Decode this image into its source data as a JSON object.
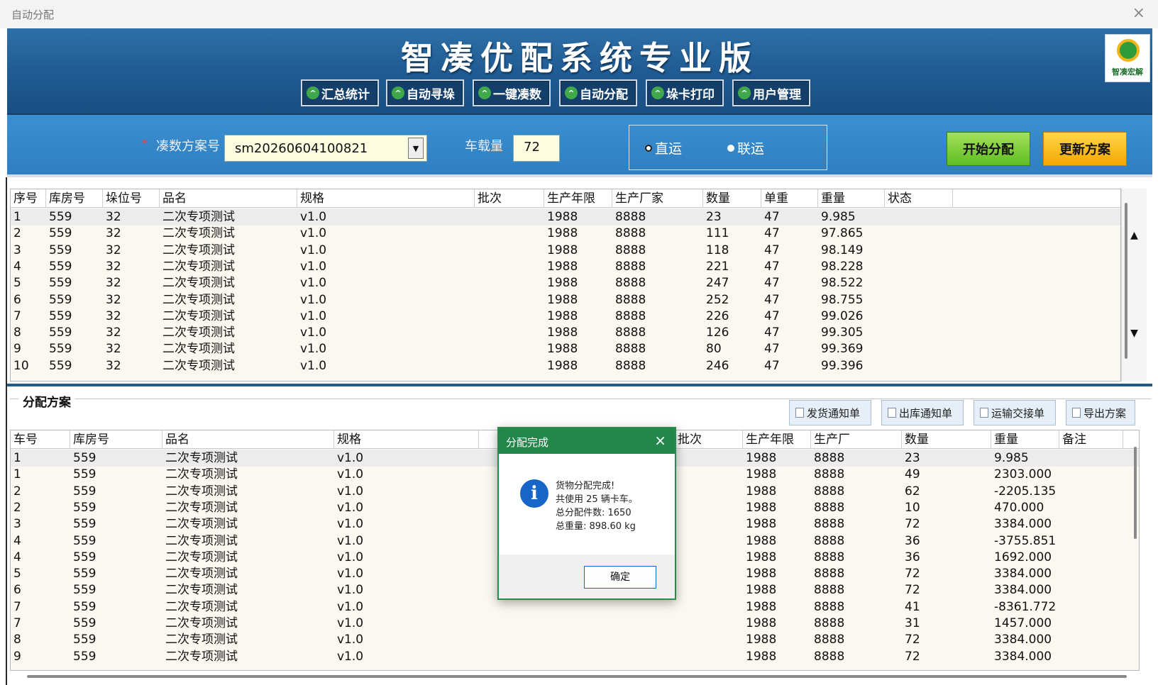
{
  "window": {
    "title": "自动分配"
  },
  "header": {
    "title": "智凑优配系统专业版",
    "nav": [
      "汇总统计",
      "自动寻垛",
      "一键凑数",
      "自动分配",
      "垛卡打印",
      "用户管理"
    ],
    "logo_text": "智凑宏解"
  },
  "controls": {
    "scheme_label": "凑数方案号",
    "scheme_value": "sm20260604100821",
    "load_label": "车载量",
    "load_value": "72",
    "radio_direct": "直运",
    "radio_combined": "联运",
    "start_button": "开始分配",
    "update_button": "更新方案"
  },
  "top_table": {
    "columns": [
      "序号",
      "库房号",
      "垛位号",
      "品名",
      "规格",
      "批次",
      "生产年限",
      "生产厂家",
      "数量",
      "单重",
      "重量",
      "状态"
    ],
    "rows": [
      [
        "1",
        "559",
        "32",
        "二次专项测试",
        "v1.0",
        "",
        "1988",
        "8888",
        "23",
        "47",
        "9.985",
        ""
      ],
      [
        "2",
        "559",
        "32",
        "二次专项测试",
        "v1.0",
        "",
        "1988",
        "8888",
        "111",
        "47",
        "97.865",
        ""
      ],
      [
        "3",
        "559",
        "32",
        "二次专项测试",
        "v1.0",
        "",
        "1988",
        "8888",
        "118",
        "47",
        "98.149",
        ""
      ],
      [
        "4",
        "559",
        "32",
        "二次专项测试",
        "v1.0",
        "",
        "1988",
        "8888",
        "221",
        "47",
        "98.228",
        ""
      ],
      [
        "5",
        "559",
        "32",
        "二次专项测试",
        "v1.0",
        "",
        "1988",
        "8888",
        "247",
        "47",
        "98.522",
        ""
      ],
      [
        "6",
        "559",
        "32",
        "二次专项测试",
        "v1.0",
        "",
        "1988",
        "8888",
        "252",
        "47",
        "98.755",
        ""
      ],
      [
        "7",
        "559",
        "32",
        "二次专项测试",
        "v1.0",
        "",
        "1988",
        "8888",
        "226",
        "47",
        "99.026",
        ""
      ],
      [
        "8",
        "559",
        "32",
        "二次专项测试",
        "v1.0",
        "",
        "1988",
        "8888",
        "126",
        "47",
        "99.305",
        ""
      ],
      [
        "9",
        "559",
        "32",
        "二次专项测试",
        "v1.0",
        "",
        "1988",
        "8888",
        "80",
        "47",
        "99.369",
        ""
      ],
      [
        "10",
        "559",
        "32",
        "二次专项测试",
        "v1.0",
        "",
        "1988",
        "8888",
        "246",
        "47",
        "99.396",
        ""
      ]
    ]
  },
  "section": {
    "title": "分配方案",
    "buttons": [
      "发货通知单",
      "出库通知单",
      "运输交接单",
      "导出方案"
    ]
  },
  "bottom_table": {
    "columns": [
      "车号",
      "库房号",
      "品名",
      "规格",
      "",
      "批次",
      "生产年限",
      "生产厂",
      "数量",
      "重量",
      "备注"
    ],
    "rows": [
      [
        "1",
        "559",
        "二次专项测试",
        "v1.0",
        "",
        "",
        "1988",
        "8888",
        "23",
        "9.985",
        ""
      ],
      [
        "1",
        "559",
        "二次专项测试",
        "v1.0",
        "",
        "",
        "1988",
        "8888",
        "49",
        "2303.000",
        ""
      ],
      [
        "2",
        "559",
        "二次专项测试",
        "v1.0",
        "",
        "",
        "1988",
        "8888",
        "62",
        "-2205.135",
        ""
      ],
      [
        "2",
        "559",
        "二次专项测试",
        "v1.0",
        "",
        "",
        "1988",
        "8888",
        "10",
        "470.000",
        ""
      ],
      [
        "3",
        "559",
        "二次专项测试",
        "v1.0",
        "",
        "",
        "1988",
        "8888",
        "72",
        "3384.000",
        ""
      ],
      [
        "4",
        "559",
        "二次专项测试",
        "v1.0",
        "",
        "",
        "1988",
        "8888",
        "36",
        "-3755.851",
        ""
      ],
      [
        "4",
        "559",
        "二次专项测试",
        "v1.0",
        "",
        "",
        "1988",
        "8888",
        "36",
        "1692.000",
        ""
      ],
      [
        "5",
        "559",
        "二次专项测试",
        "v1.0",
        "",
        "",
        "1988",
        "8888",
        "72",
        "3384.000",
        ""
      ],
      [
        "6",
        "559",
        "二次专项测试",
        "v1.0",
        "",
        "",
        "1988",
        "8888",
        "72",
        "3384.000",
        ""
      ],
      [
        "7",
        "559",
        "二次专项测试",
        "v1.0",
        "",
        "",
        "1988",
        "8888",
        "41",
        "-8361.772",
        ""
      ],
      [
        "7",
        "559",
        "二次专项测试",
        "v1.0",
        "",
        "",
        "1988",
        "8888",
        "31",
        "1457.000",
        ""
      ],
      [
        "8",
        "559",
        "二次专项测试",
        "v1.0",
        "",
        "",
        "1988",
        "8888",
        "72",
        "3384.000",
        ""
      ],
      [
        "9",
        "559",
        "二次专项测试",
        "v1.0",
        "",
        "",
        "1988",
        "8888",
        "72",
        "3384.000",
        ""
      ]
    ]
  },
  "dialog": {
    "title": "分配完成",
    "line1": "货物分配完成!",
    "line2": "共使用 25 辆卡车。",
    "line3": "总分配件数: 1650",
    "line4": "总重量: 898.60 kg",
    "ok": "确定"
  },
  "icons": {
    "info": "i",
    "close": "×"
  }
}
